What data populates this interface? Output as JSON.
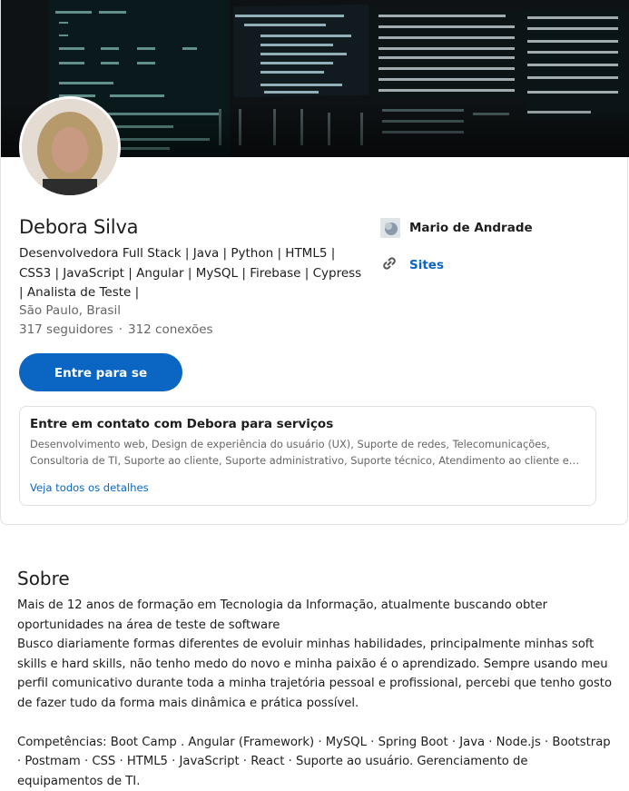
{
  "profile": {
    "name": "Debora Silva",
    "headline": "Desenvolvedora Full Stack | Java | Python | HTML5 | CSS3 | JavaScript | Angular | MySQL | Firebase | Cypress | Analista de Teste |",
    "location": "São Paulo, Brasil",
    "followers": "317 seguidores",
    "separator": "·",
    "connections": "312 conexões",
    "connect_label": "Entre para se conectar"
  },
  "sidebar": {
    "company": "Mario de Andrade",
    "sites": "Sites"
  },
  "services": {
    "title": "Entre em contato com Debora para serviços",
    "list": "Desenvolvimento web, Design de experiência do usuário (UX), Suporte de redes, Telecomunicações, Consultoria de TI, Suporte ao cliente, Suporte administrativo, Suporte técnico, Atendimento ao cliente e Suporte administrativo de escritório",
    "link": "Veja todos os detalhes"
  },
  "about": {
    "title": "Sobre",
    "p1": "Mais de 12 anos de formação em Tecnologia da Informação, atualmente buscando obter oportunidades na área de teste de software",
    "p2": "Busco diariamente formas diferentes de evoluir minhas habilidades, principalmente minhas soft skills e hard skills, não tenho medo do novo e minha paixão é o aprendizado. Sempre usando meu perfil comunicativo durante toda a minha trajetória pessoal e profissional, percebi que tenho gosto de fazer tudo da forma mais dinâmica e prática possível.",
    "p3": "Competências: Boot Camp . Angular (Framework) · MySQL · Spring Boot · Java · Node.js · Bootstrap · Postmam · CSS · HTML5 · JavaScript · React · Suporte ao usuário. Gerenciamento de equipamentos de TI."
  },
  "colors": {
    "accent": "#0a66c2",
    "muted_text": "#666666",
    "cover_bg": "#0e1214"
  }
}
